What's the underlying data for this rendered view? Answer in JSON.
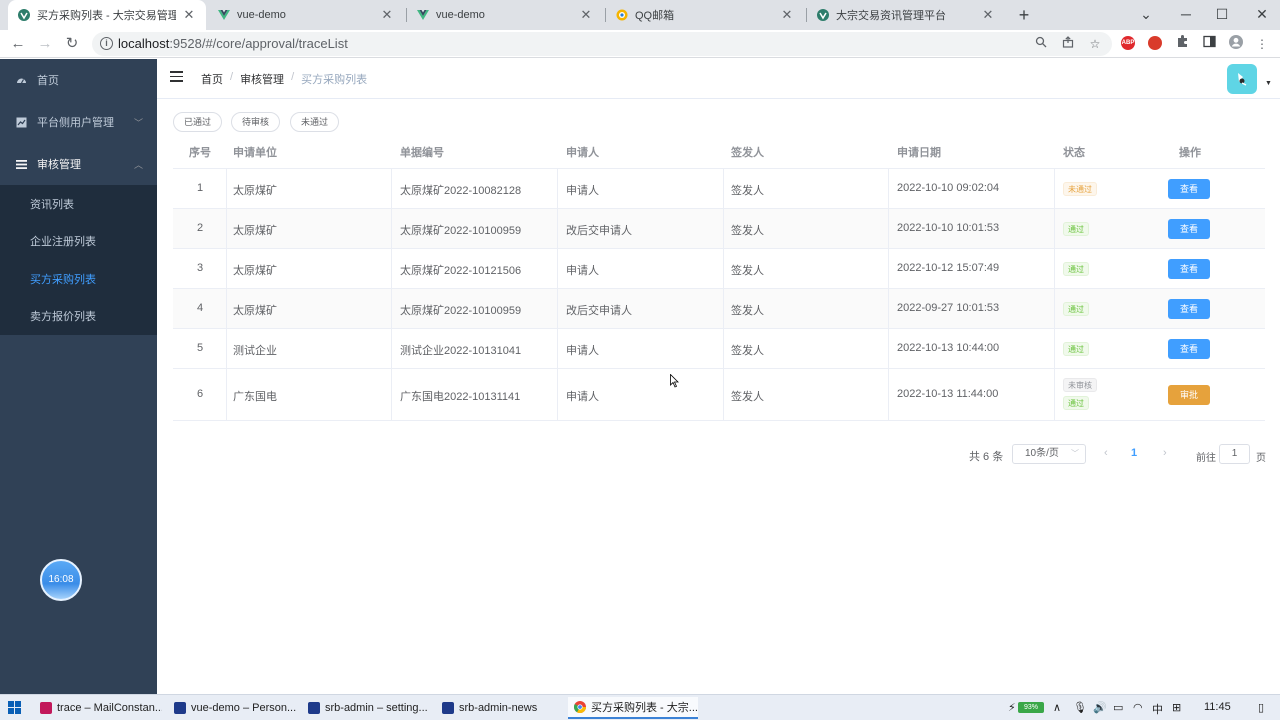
{
  "browser": {
    "tabs": [
      {
        "title": "买方采购列表 - 大宗交易管理平台",
        "active": true
      },
      {
        "title": "vue-demo",
        "active": false
      },
      {
        "title": "vue-demo",
        "active": false
      },
      {
        "title": "QQ邮箱",
        "active": false
      },
      {
        "title": "大宗交易资讯管理平台",
        "active": false
      }
    ],
    "url_host": "localhost",
    "url_path": ":9528/#/core/approval/traceList",
    "extensions": [
      "ABP"
    ]
  },
  "sidebar": {
    "items": [
      {
        "label": "首页",
        "icon": "dashboard-icon"
      },
      {
        "label": "平台侧用户管理",
        "icon": "chart-icon"
      },
      {
        "label": "审核管理",
        "icon": "list-icon"
      }
    ],
    "subitems": [
      {
        "label": "资讯列表"
      },
      {
        "label": "企业注册列表"
      },
      {
        "label": "买方采购列表"
      },
      {
        "label": "卖方报价列表"
      }
    ],
    "clock_time": "16:08"
  },
  "header": {
    "breadcrumb": [
      "首页",
      "审核管理",
      "买方采购列表"
    ]
  },
  "filters": [
    {
      "label": "已通过"
    },
    {
      "label": "待审核"
    },
    {
      "label": "未通过"
    }
  ],
  "table": {
    "columns": [
      "序号",
      "申请单位",
      "单据编号",
      "申请人",
      "签发人",
      "申请日期",
      "状态",
      "操作"
    ],
    "rows": [
      {
        "index": "1",
        "unit": "太原煤矿",
        "code": "太原煤矿2022-10082128",
        "applicant": "申请人",
        "issuer": "签发人",
        "date": "2022-10-10 09:02:04",
        "status": [
          "未通过"
        ],
        "action": "查看"
      },
      {
        "index": "2",
        "unit": "太原煤矿",
        "code": "太原煤矿2022-10100959",
        "applicant": "改后交申请人",
        "issuer": "签发人",
        "date": "2022-10-10 10:01:53",
        "status": [
          "通过"
        ],
        "action": "查看"
      },
      {
        "index": "3",
        "unit": "太原煤矿",
        "code": "太原煤矿2022-10121506",
        "applicant": "申请人",
        "issuer": "签发人",
        "date": "2022-10-12 15:07:49",
        "status": [
          "通过"
        ],
        "action": "查看"
      },
      {
        "index": "4",
        "unit": "太原煤矿",
        "code": "太原煤矿2022-10100959",
        "applicant": "改后交申请人",
        "issuer": "签发人",
        "date": "2022-09-27 10:01:53",
        "status": [
          "通过"
        ],
        "action": "查看"
      },
      {
        "index": "5",
        "unit": "测试企业",
        "code": "测试企业2022-10131041",
        "applicant": "申请人",
        "issuer": "签发人",
        "date": "2022-10-13 10:44:00",
        "status": [
          "通过"
        ],
        "action": "查看"
      },
      {
        "index": "6",
        "unit": "广东国电",
        "code": "广东国电2022-10131141",
        "applicant": "申请人",
        "issuer": "签发人",
        "date": "2022-10-13 11:44:00",
        "status": [
          "未审核",
          "通过"
        ],
        "action": "审批"
      }
    ]
  },
  "pagination": {
    "total": "共 6 条",
    "page_size": "10条/页",
    "current_page": "1",
    "goto_label": "前往",
    "goto_value": "1",
    "page_unit": "页"
  },
  "taskbar": {
    "tasks": [
      {
        "label": "trace – MailConstan...",
        "color": "#c2185b"
      },
      {
        "label": "vue-demo – Person...",
        "color": "#1e3a8a"
      },
      {
        "label": "srb-admin – setting...",
        "color": "#1e3a8a"
      },
      {
        "label": "srb-admin-news",
        "color": "#1e3a8a"
      },
      {
        "label": "买方采购列表 - 大宗...",
        "color": "#ea4335"
      }
    ],
    "battery": "93%",
    "ime": "中",
    "time": "11:45"
  },
  "colors": {
    "sidebar_bg": "#304156",
    "submenu_bg": "#1f2d3d",
    "accent": "#409eff",
    "warning": "#e6a23c",
    "success": "#67c23a"
  }
}
